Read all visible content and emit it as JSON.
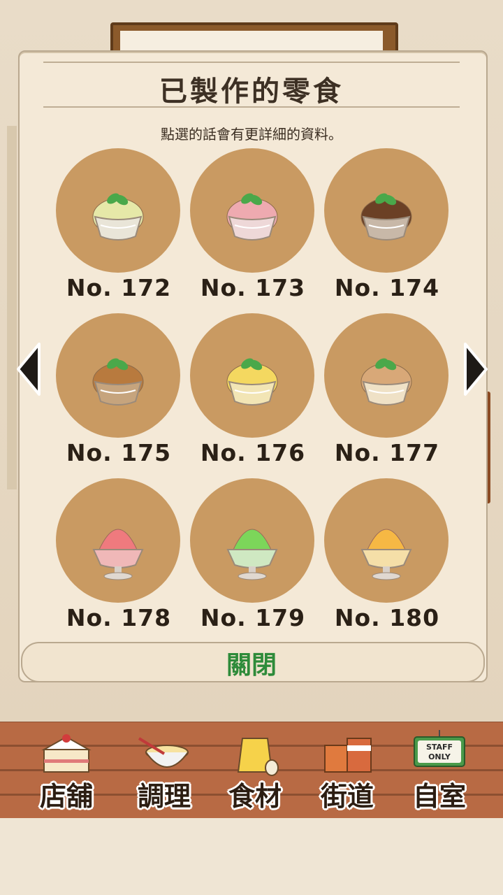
{
  "panel": {
    "title": "已製作的零食",
    "subtitle": "點選的話會有更詳細的資料。",
    "close_label": "關閉"
  },
  "items": [
    {
      "label": "No. 172",
      "kind": "ice-cream",
      "cream": "#e6e8a8",
      "bowl": "#e9e5d8"
    },
    {
      "label": "No. 173",
      "kind": "ice-cream",
      "cream": "#eeaab0",
      "bowl": "#eed8d8"
    },
    {
      "label": "No. 174",
      "kind": "ice-cream",
      "cream": "#6b4025",
      "bowl": "#c8b8a8"
    },
    {
      "label": "No. 175",
      "kind": "ice-cream",
      "cream": "#b87a3e",
      "bowl": "#c6a47d"
    },
    {
      "label": "No. 176",
      "kind": "ice-cream",
      "cream": "#f4d860",
      "bowl": "#f2e5b5"
    },
    {
      "label": "No. 177",
      "kind": "ice-cream",
      "cream": "#d8a878",
      "bowl": "#efe1c6"
    },
    {
      "label": "No. 178",
      "kind": "shaved-ice",
      "cream": "#ef7a7e",
      "bowl": "#f0b8b8"
    },
    {
      "label": "No. 179",
      "kind": "shaved-ice",
      "cream": "#7cd65a",
      "bowl": "#cfe8c2"
    },
    {
      "label": "No. 180",
      "kind": "shaved-ice",
      "cream": "#f6b844",
      "bowl": "#f5dfa8"
    }
  ],
  "nav": [
    {
      "label": "店舖",
      "icon": "cake-icon"
    },
    {
      "label": "調理",
      "icon": "mixing-bowl-icon"
    },
    {
      "label": "食材",
      "icon": "flour-sack-icon"
    },
    {
      "label": "街道",
      "icon": "shop-street-icon"
    },
    {
      "label": "自室",
      "icon": "staff-only-sign-icon",
      "sign_text": "STAFF ONLY"
    }
  ],
  "colors": {
    "circle": "#c99a62",
    "close_green": "#2e8b3a",
    "mint": "#4aa84a"
  }
}
